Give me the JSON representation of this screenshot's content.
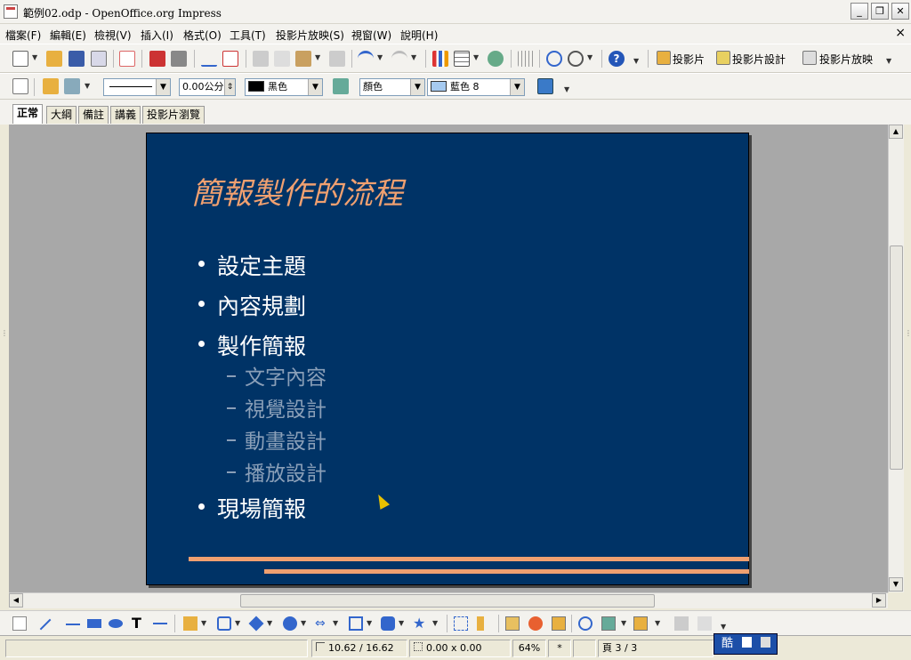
{
  "window": {
    "title": "範例02.odp - OpenOffice.org Impress",
    "minimize": "_",
    "restore": "❐",
    "close": "✕"
  },
  "menu": {
    "items": [
      "檔案(F)",
      "編輯(E)",
      "檢視(V)",
      "插入(I)",
      "格式(O)",
      "工具(T)",
      "投影片放映(S)",
      "視窗(W)",
      "說明(H)"
    ],
    "close_doc": "×"
  },
  "toolbar1": {
    "slide_label": "投影片",
    "slide_design_label": "投影片設計",
    "slideshow_label": "投影片放映"
  },
  "toolbar2": {
    "line_width": "0.00公分",
    "line_color": "黑色",
    "area_style": "顏色",
    "area_color": "藍色 8",
    "colors": {
      "line": "#000000",
      "area": "#a6caf0"
    }
  },
  "view_tabs": [
    "正常",
    "大綱",
    "備註",
    "講義",
    "投影片瀏覽"
  ],
  "slide": {
    "title": "簡報製作的流程",
    "bullets": [
      "設定主題",
      "內容規劃",
      "製作簡報"
    ],
    "sub_bullets": [
      "文字內容",
      "視覺設計",
      "動畫設計",
      "播放設計"
    ],
    "last_bullet": "現場簡報",
    "colors": {
      "background": "#003366",
      "title": "#f0a070",
      "stripe": "#f0a070"
    }
  },
  "status": {
    "position": "10.62 / 16.62",
    "size": "0.00 x 0.00",
    "zoom": "64%",
    "modified": "*",
    "page": "頁 3 / 3"
  },
  "ime": {
    "label": "酷"
  }
}
